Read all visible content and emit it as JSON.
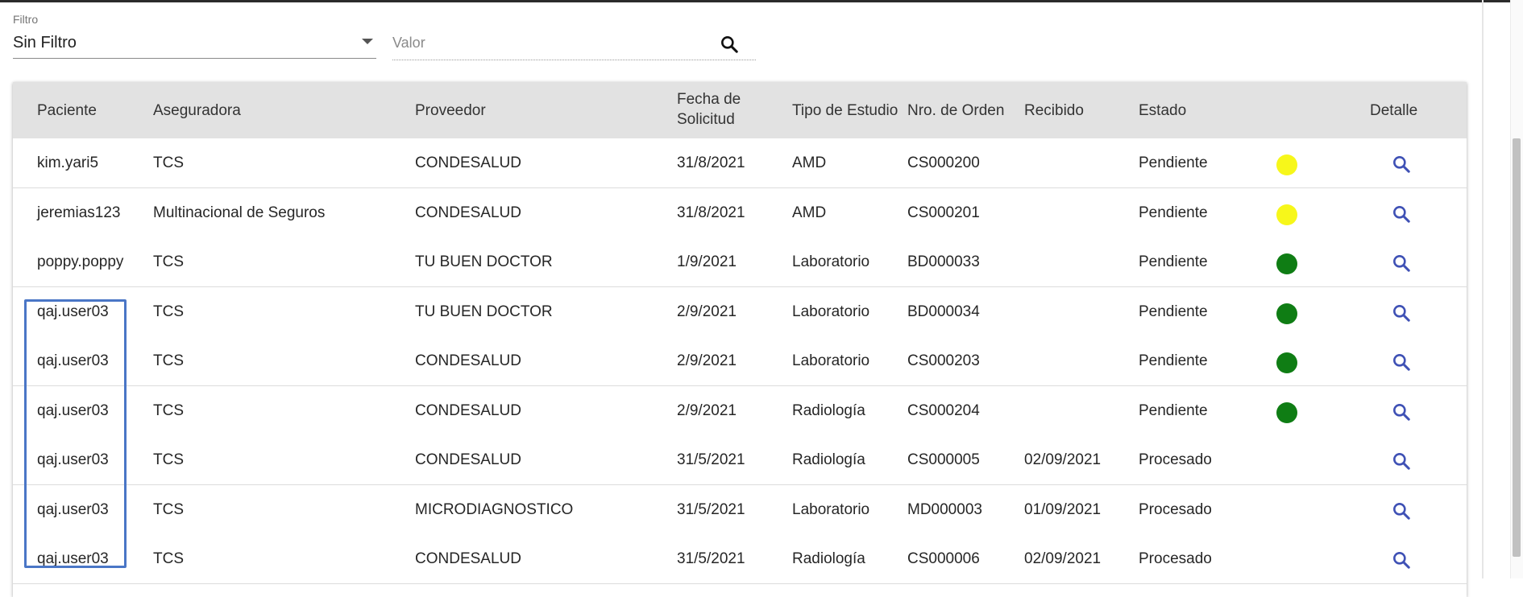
{
  "filter": {
    "label": "Filtro",
    "selected": "Sin Filtro",
    "value_placeholder": "Valor",
    "value": ""
  },
  "table": {
    "headers": {
      "paciente": "Paciente",
      "aseguradora": "Aseguradora",
      "proveedor": "Proveedor",
      "fecha_line1": "Fecha de",
      "fecha_line2": "Solicitud",
      "tipo": "Tipo de Estudio",
      "orden": "Nro. de Orden",
      "recibido": "Recibido",
      "estado": "Estado",
      "detalle": "Detalle"
    },
    "rows": [
      {
        "paciente": "kim.yari5",
        "aseguradora": "TCS",
        "proveedor": "CONDESALUD",
        "fecha": "31/8/2021",
        "tipo": "AMD",
        "orden": "CS000200",
        "recibido": "",
        "estado": "Pendiente",
        "indicator": "yellow"
      },
      {
        "paciente": "jeremias123",
        "aseguradora": "Multinacional de Seguros",
        "proveedor": "CONDESALUD",
        "fecha": "31/8/2021",
        "tipo": "AMD",
        "orden": "CS000201",
        "recibido": "",
        "estado": "Pendiente",
        "indicator": "yellow"
      },
      {
        "paciente": "poppy.poppy",
        "aseguradora": "TCS",
        "proveedor": "TU BUEN DOCTOR",
        "fecha": "1/9/2021",
        "tipo": "Laboratorio",
        "orden": "BD000033",
        "recibido": "",
        "estado": "Pendiente",
        "indicator": "green"
      },
      {
        "paciente": "qaj.user03",
        "aseguradora": "TCS",
        "proveedor": "TU BUEN DOCTOR",
        "fecha": "2/9/2021",
        "tipo": "Laboratorio",
        "orden": "BD000034",
        "recibido": "",
        "estado": "Pendiente",
        "indicator": "green"
      },
      {
        "paciente": "qaj.user03",
        "aseguradora": "TCS",
        "proveedor": "CONDESALUD",
        "fecha": "2/9/2021",
        "tipo": "Laboratorio",
        "orden": "CS000203",
        "recibido": "",
        "estado": "Pendiente",
        "indicator": "green"
      },
      {
        "paciente": "qaj.user03",
        "aseguradora": "TCS",
        "proveedor": "CONDESALUD",
        "fecha": "2/9/2021",
        "tipo": "Radiología",
        "orden": "CS000204",
        "recibido": "",
        "estado": "Pendiente",
        "indicator": "green"
      },
      {
        "paciente": "qaj.user03",
        "aseguradora": "TCS",
        "proveedor": "CONDESALUD",
        "fecha": "31/5/2021",
        "tipo": "Radiología",
        "orden": "CS000005",
        "recibido": "02/09/2021",
        "estado": "Procesado",
        "indicator": ""
      },
      {
        "paciente": "qaj.user03",
        "aseguradora": "TCS",
        "proveedor": "MICRODIAGNOSTICO",
        "fecha": "31/5/2021",
        "tipo": "Laboratorio",
        "orden": "MD000003",
        "recibido": "01/09/2021",
        "estado": "Procesado",
        "indicator": ""
      },
      {
        "paciente": "qaj.user03",
        "aseguradora": "TCS",
        "proveedor": "CONDESALUD",
        "fecha": "31/5/2021",
        "tipo": "Radiología",
        "orden": "CS000006",
        "recibido": "02/09/2021",
        "estado": "Procesado",
        "indicator": ""
      }
    ]
  },
  "colors": {
    "yellow": "#f7f71a",
    "green": "#0f7d14",
    "search_icon_filter": "#111111",
    "search_icon_detail": "#3f51b5",
    "highlight": "#4a76c6"
  },
  "icons": {
    "filter_search": "search-icon",
    "detail": "search-icon",
    "dropdown": "caret-down-icon"
  }
}
